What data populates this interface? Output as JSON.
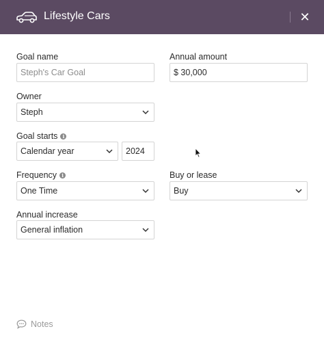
{
  "header": {
    "title": "Lifestyle Cars",
    "close_glyph": "✕",
    "bg_color": "#5b4a62",
    "icon": "car-icon"
  },
  "form": {
    "goal_name": {
      "label": "Goal name",
      "placeholder": "Steph's Car Goal"
    },
    "annual_amount": {
      "label": "Annual amount",
      "value": "$ 30,000"
    },
    "owner": {
      "label": "Owner",
      "value": "Steph"
    },
    "goal_starts": {
      "label": "Goal starts",
      "period": "Calendar year",
      "year": "2024"
    },
    "frequency": {
      "label": "Frequency",
      "value": "One Time"
    },
    "buy_or_lease": {
      "label": "Buy or lease",
      "value": "Buy"
    },
    "annual_increase": {
      "label": "Annual increase",
      "value": "General inflation"
    }
  },
  "footer": {
    "notes_label": "Notes",
    "icon": "speech-bubble-icon"
  }
}
